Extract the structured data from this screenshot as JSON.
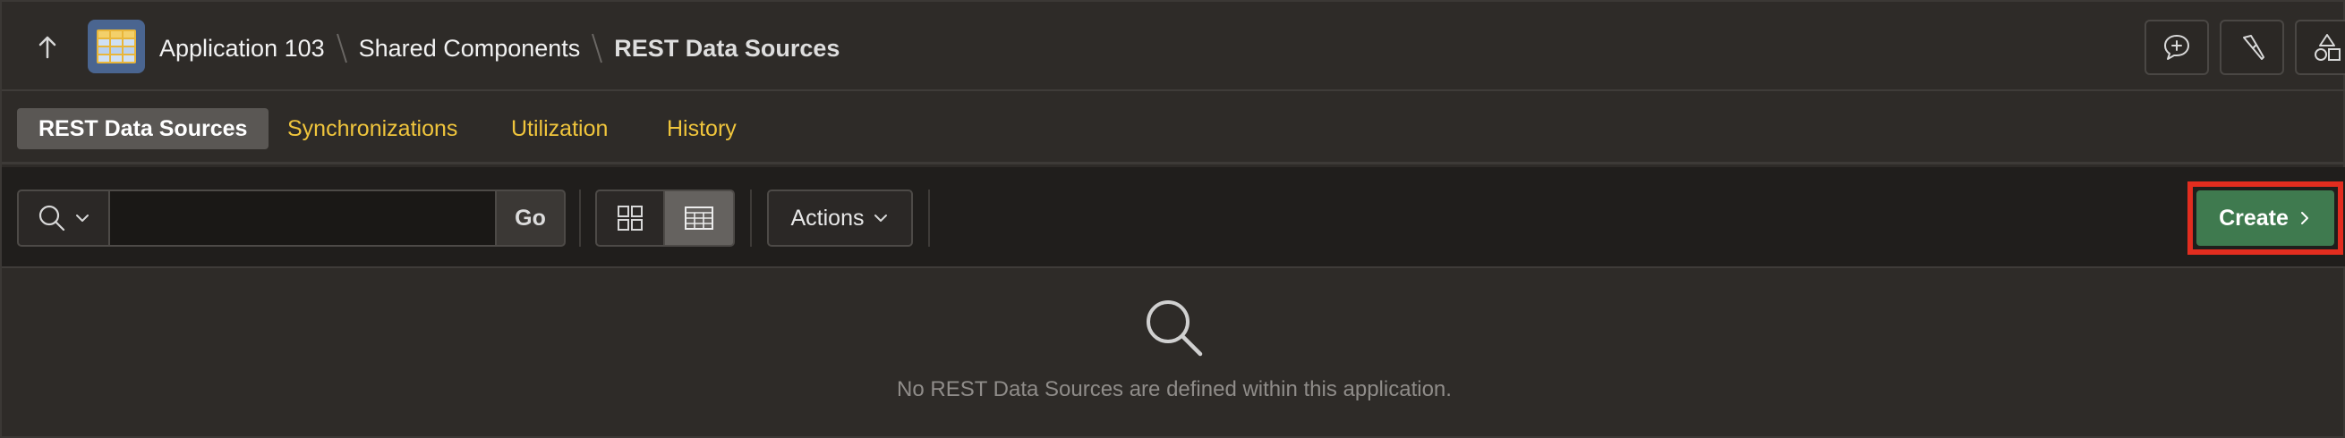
{
  "header": {
    "breadcrumb": {
      "app": "Application 103",
      "shared": "Shared Components",
      "current": "REST Data Sources"
    },
    "tools": [
      "chat-icon",
      "flashlight-icon",
      "shapes-icon"
    ]
  },
  "tabs": [
    {
      "label": "REST Data Sources",
      "active": true
    },
    {
      "label": "Synchronizations",
      "active": false
    },
    {
      "label": "Utilization",
      "active": false
    },
    {
      "label": "History",
      "active": false
    }
  ],
  "toolbar": {
    "search": {
      "value": "",
      "placeholder": ""
    },
    "go_label": "Go",
    "view_modes": [
      "icons-view-icon",
      "report-view-icon"
    ],
    "selected_view": "report",
    "actions_label": "Actions",
    "create_label": "Create"
  },
  "empty_state": {
    "message": "No REST Data Sources are defined within this application."
  },
  "colors": {
    "tab_link": "#f0c53c",
    "create_button": "#3f7a4f",
    "highlight_outline": "#e22d1f"
  }
}
